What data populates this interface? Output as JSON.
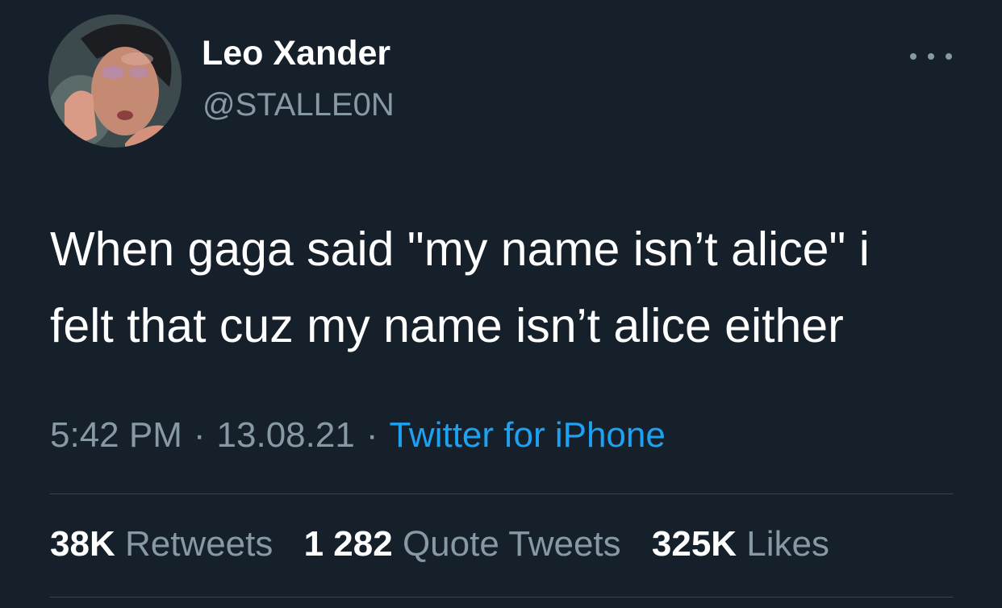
{
  "user": {
    "display_name": "Leo Xander",
    "handle": "@STALLE0N",
    "avatar_icon": "profile-photo"
  },
  "more_icon": "ellipsis-icon",
  "tweet": {
    "lines": [
      "When gaga said \"my name isn’t alice\" i",
      "felt that cuz my name isn’t alice either"
    ]
  },
  "meta": {
    "time": "5:42 PM",
    "date": "13.08.21",
    "separator": "·",
    "source": "Twitter for iPhone"
  },
  "stats": {
    "retweets_count": "38K",
    "retweets_label": "Retweets",
    "quotes_count": "1 282",
    "quotes_label": "Quote Tweets",
    "likes_count": "325K",
    "likes_label": "Likes"
  },
  "colors": {
    "background": "#15202b",
    "primary_text": "#ffffff",
    "secondary_text": "#8899a6",
    "accent": "#1da1f2",
    "divider": "#38444d"
  }
}
